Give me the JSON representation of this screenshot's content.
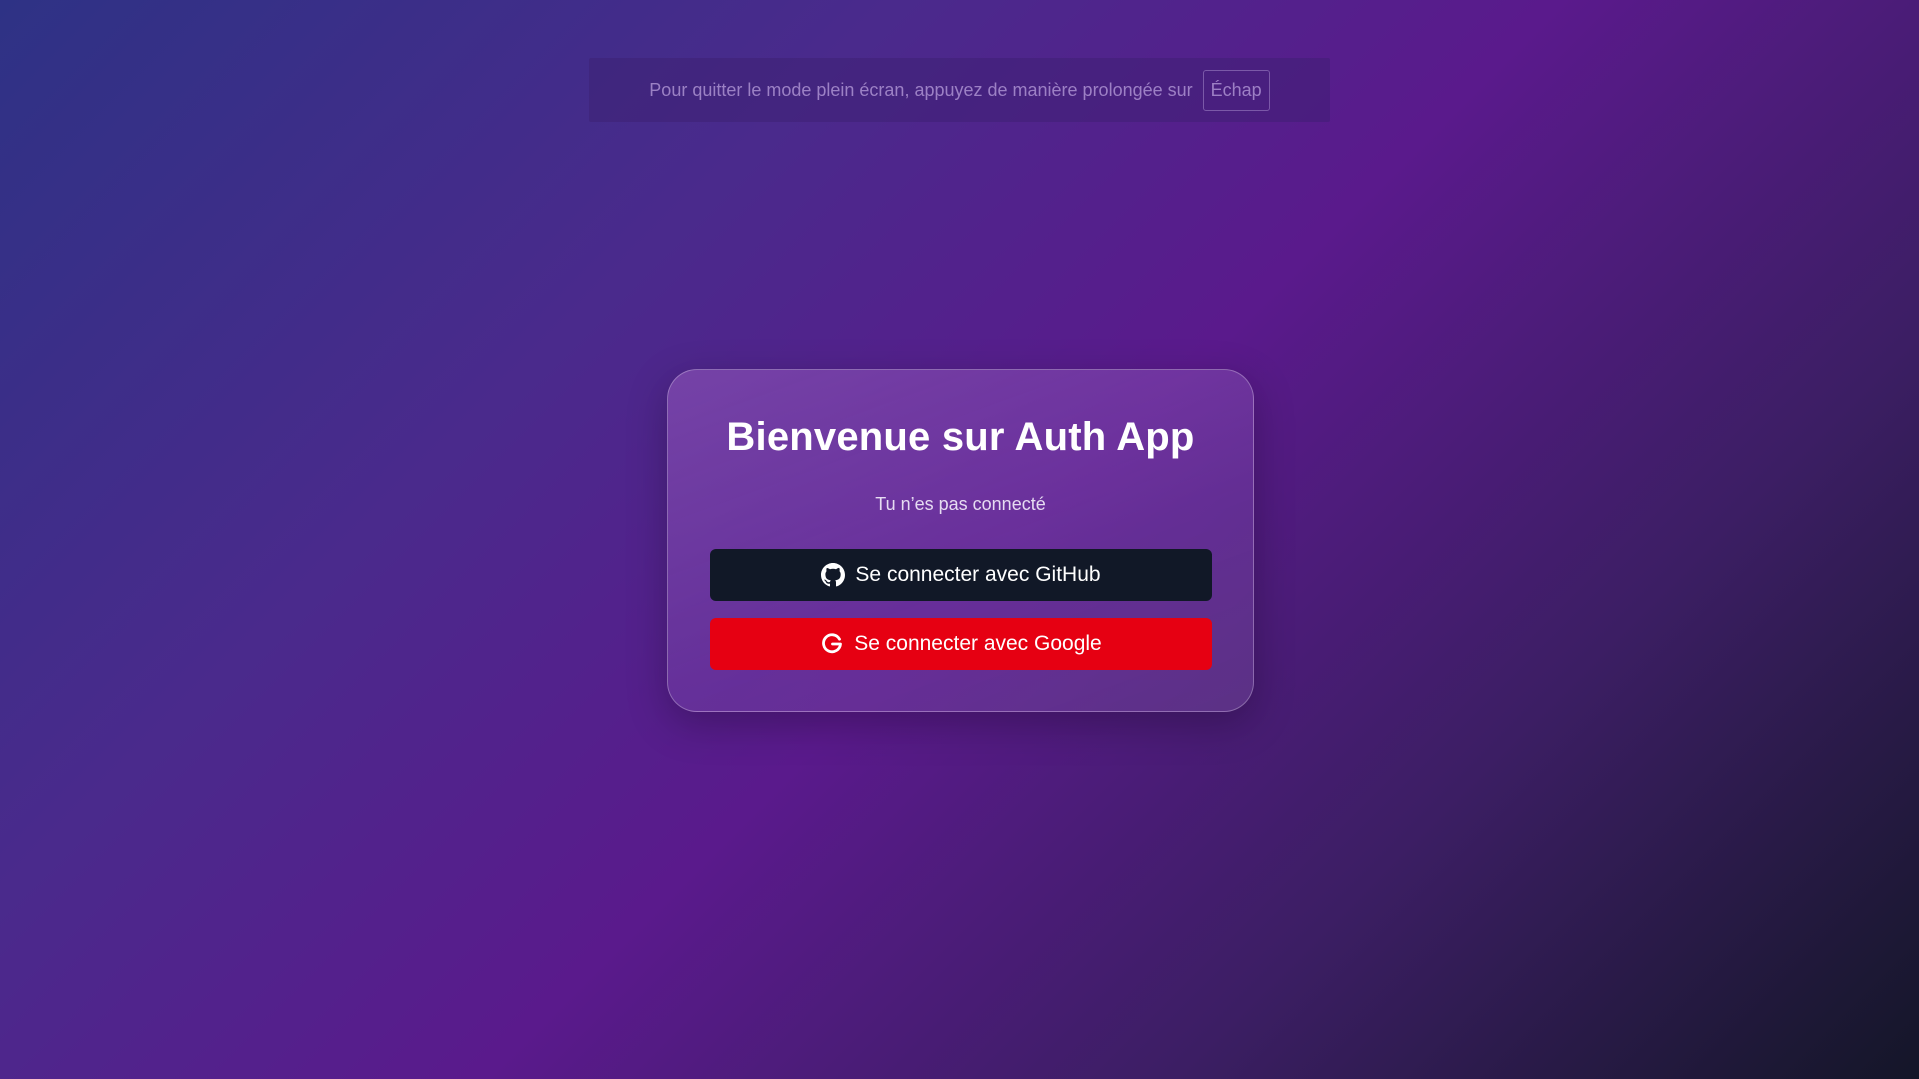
{
  "fullscreen_notice": {
    "text": "Pour quitter le mode plein écran, appuyez de manière prolongée sur",
    "key": "Échap"
  },
  "card": {
    "title": "Bienvenue sur Auth App",
    "status": "Tu n’es pas connecté",
    "github_button": {
      "label": "Se connecter avec GitHub",
      "icon": "github-icon",
      "color": "#111827"
    },
    "google_button": {
      "label": "Se connecter avec Google",
      "icon": "google-icon",
      "color": "#e60012"
    }
  }
}
